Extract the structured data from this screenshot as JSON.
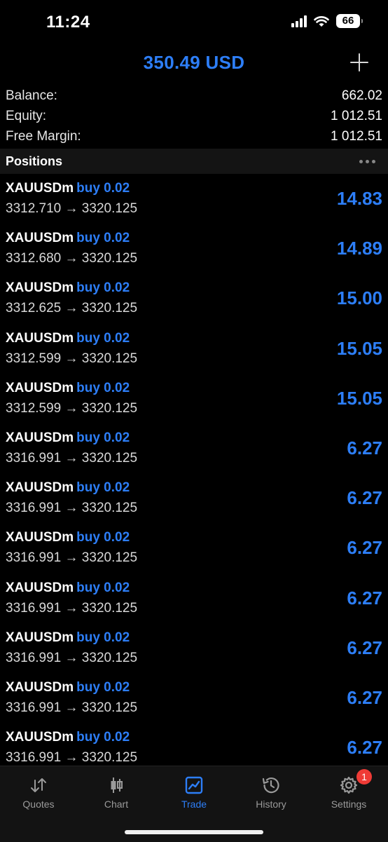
{
  "status_bar": {
    "time": "11:24",
    "battery": "66"
  },
  "header": {
    "title": "350.49 USD"
  },
  "summary": [
    {
      "label": "Balance:",
      "value": "662.02"
    },
    {
      "label": "Equity:",
      "value": "1 012.51"
    },
    {
      "label": "Free Margin:",
      "value": "1 012.51"
    }
  ],
  "positions": {
    "title": "Positions",
    "rows": [
      {
        "symbol": "XAUUSDm",
        "side": "buy 0.02",
        "prices": "3312.710 → 3320.125",
        "profit": "14.83"
      },
      {
        "symbol": "XAUUSDm",
        "side": "buy 0.02",
        "prices": "3312.680 → 3320.125",
        "profit": "14.89"
      },
      {
        "symbol": "XAUUSDm",
        "side": "buy 0.02",
        "prices": "3312.625 → 3320.125",
        "profit": "15.00"
      },
      {
        "symbol": "XAUUSDm",
        "side": "buy 0.02",
        "prices": "3312.599 → 3320.125",
        "profit": "15.05"
      },
      {
        "symbol": "XAUUSDm",
        "side": "buy 0.02",
        "prices": "3312.599 → 3320.125",
        "profit": "15.05"
      },
      {
        "symbol": "XAUUSDm",
        "side": "buy 0.02",
        "prices": "3316.991 → 3320.125",
        "profit": "6.27"
      },
      {
        "symbol": "XAUUSDm",
        "side": "buy 0.02",
        "prices": "3316.991 → 3320.125",
        "profit": "6.27"
      },
      {
        "symbol": "XAUUSDm",
        "side": "buy 0.02",
        "prices": "3316.991 → 3320.125",
        "profit": "6.27"
      },
      {
        "symbol": "XAUUSDm",
        "side": "buy 0.02",
        "prices": "3316.991 → 3320.125",
        "profit": "6.27"
      },
      {
        "symbol": "XAUUSDm",
        "side": "buy 0.02",
        "prices": "3316.991 → 3320.125",
        "profit": "6.27"
      },
      {
        "symbol": "XAUUSDm",
        "side": "buy 0.02",
        "prices": "3316.991 → 3320.125",
        "profit": "6.27"
      },
      {
        "symbol": "XAUUSDm",
        "side": "buy 0.02",
        "prices": "3316.991 → 3320.125",
        "profit": "6.27"
      }
    ]
  },
  "tabs": [
    {
      "label": "Quotes",
      "icon": "quotes-arrows-icon"
    },
    {
      "label": "Chart",
      "icon": "candlestick-chart-icon"
    },
    {
      "label": "Trade",
      "icon": "trade-chart-icon",
      "active": true
    },
    {
      "label": "History",
      "icon": "history-clock-icon"
    },
    {
      "label": "Settings",
      "icon": "settings-gear-icon",
      "badge": "1"
    }
  ],
  "colors": {
    "accent": "#2d7ef7",
    "badge": "#ef3b36",
    "background": "#000000"
  }
}
